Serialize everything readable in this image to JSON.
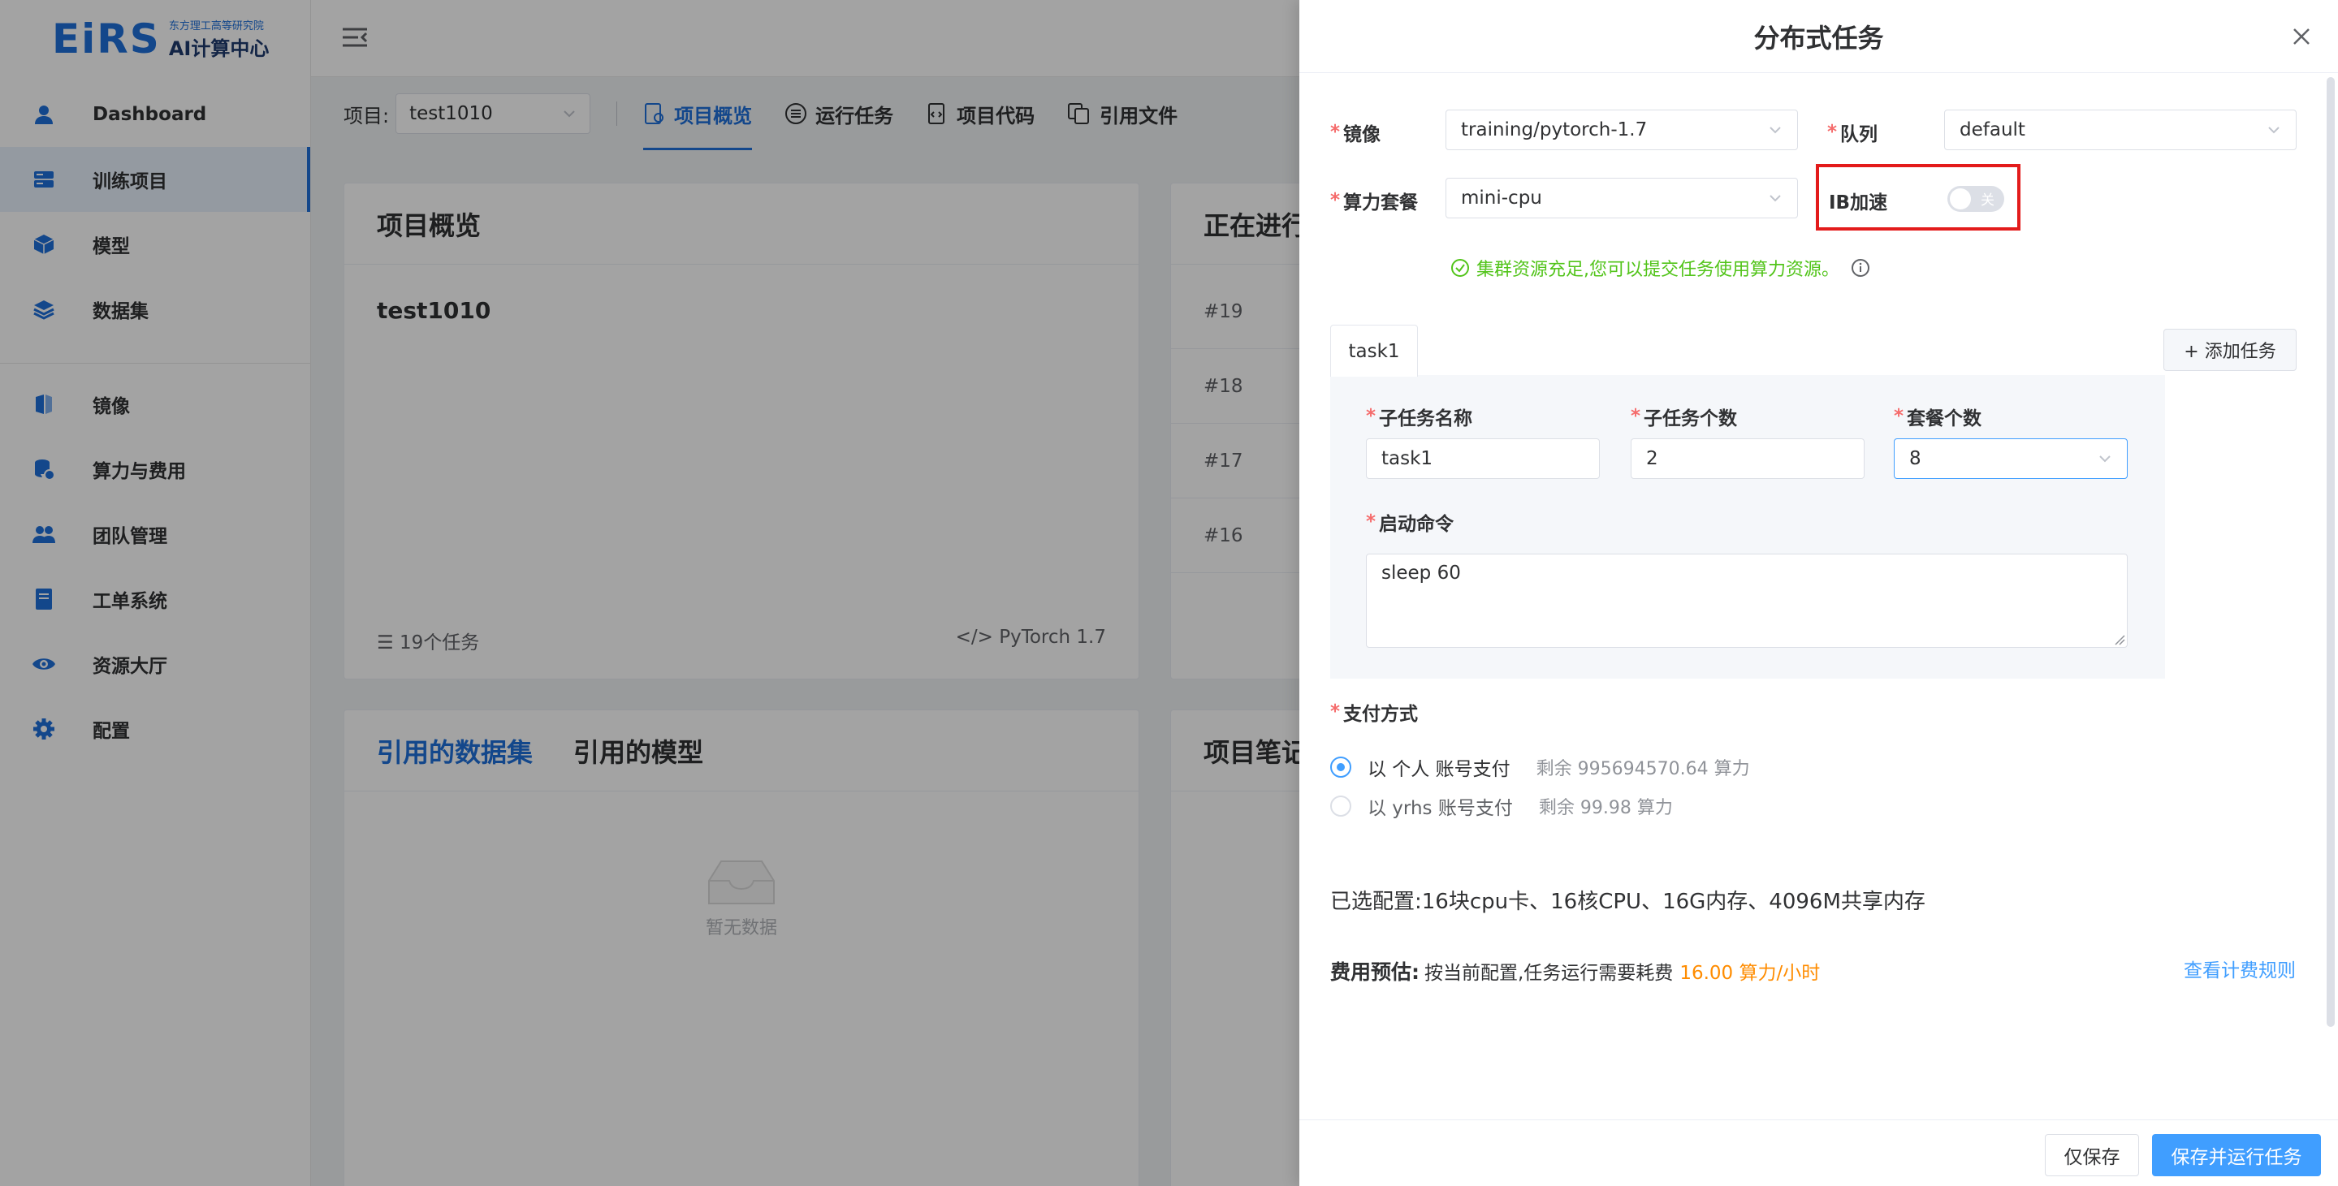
{
  "logo": {
    "mark": "EiRS",
    "sub": "东方理工高等研究院",
    "title": "AI计算中心"
  },
  "sidebar": {
    "items": [
      {
        "label": "Dashboard"
      },
      {
        "label": "训练项目"
      },
      {
        "label": "模型"
      },
      {
        "label": "数据集"
      },
      {
        "label": "镜像"
      },
      {
        "label": "算力与费用"
      },
      {
        "label": "团队管理"
      },
      {
        "label": "工单系统"
      },
      {
        "label": "资源大厅"
      },
      {
        "label": "配置"
      }
    ]
  },
  "subnav": {
    "project_label": "项目:",
    "project_value": "test1010",
    "tabs": [
      {
        "label": "项目概览"
      },
      {
        "label": "运行任务"
      },
      {
        "label": "项目代码"
      },
      {
        "label": "引用文件"
      }
    ]
  },
  "overview": {
    "title": "项目概览",
    "name": "test1010",
    "task_count": "19个任务",
    "framework": "PyTorch 1.7"
  },
  "running": {
    "title": "正在进行",
    "rows": [
      "#19",
      "#18",
      "#17",
      "#16"
    ]
  },
  "refs": {
    "tab_datasets": "引用的数据集",
    "tab_models": "引用的模型",
    "empty": "暂无数据"
  },
  "notes": {
    "title": "项目笔记"
  },
  "drawer": {
    "title": "分布式任务",
    "image_label": "镜像",
    "image_value": "training/pytorch-1.7",
    "queue_label": "队列",
    "queue_value": "default",
    "package_label": "算力套餐",
    "package_value": "mini-cpu",
    "ib_label": "IB加速",
    "ib_toggle_text": "关",
    "resource_msg": "集群资源充足,您可以提交任务使用算力资源。",
    "task_tab": "task1",
    "add_task": "+ 添加任务",
    "subtask_name_label": "子任务名称",
    "subtask_name_value": "task1",
    "subtask_count_label": "子任务个数",
    "subtask_count_value": "2",
    "package_count_label": "套餐个数",
    "package_count_value": "8",
    "command_label": "启动命令",
    "command_value": "sleep 60",
    "payment_label": "支付方式",
    "payments": [
      {
        "label": "以 个人 账号支付",
        "remain": "剩余 995694570.64 算力",
        "selected": true
      },
      {
        "label": "以 yrhs 账号支付",
        "remain": "剩余 99.98 算力",
        "selected": false
      }
    ],
    "selected_config": "已选配置:16块cpu卡、16核CPU、16G内存、4096M共享内存",
    "cost_label": "费用预估:",
    "cost_text": "按当前配置,任务运行需要耗费",
    "cost_value": "16.00 算力/小时",
    "pricing_link": "查看计费规则",
    "btn_save": "仅保存",
    "btn_save_run": "保存并运行任务"
  },
  "colors": {
    "primary": "#409eff",
    "brand": "#1e6fd9",
    "required": "#f56c6c",
    "success": "#52c41a",
    "highlight": "#e31b1b",
    "cost": "#ff8c00"
  }
}
